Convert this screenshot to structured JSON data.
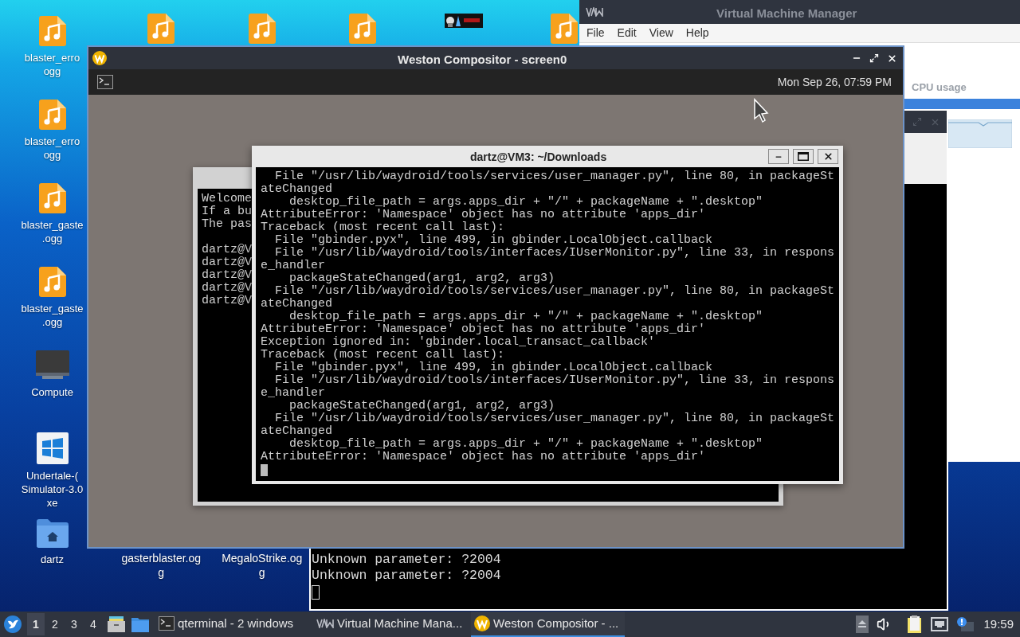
{
  "desktop": {
    "left_column": [
      {
        "kind": "audio",
        "lines": [
          "blaster_erro",
          "ogg"
        ]
      },
      {
        "kind": "audio",
        "lines": [
          "blaster_erro",
          "ogg"
        ]
      },
      {
        "kind": "audio",
        "lines": [
          "blaster_gaste",
          ".ogg"
        ]
      },
      {
        "kind": "audio",
        "lines": [
          "blaster_gaste",
          ".ogg"
        ]
      },
      {
        "kind": "computer",
        "lines": [
          "Compute"
        ]
      },
      {
        "kind": "executable",
        "lines": [
          "Undertale-(",
          "Simulator-3.0",
          "xe"
        ]
      },
      {
        "kind": "folder",
        "lines": [
          "dartz"
        ]
      }
    ],
    "top_row": [
      {
        "kind": "audio"
      },
      {
        "kind": "audio"
      },
      {
        "kind": "audio"
      },
      {
        "kind": "picture"
      },
      {
        "kind": "audio"
      }
    ],
    "bottom_row": [
      {
        "lines": [
          "gasterblaster.og",
          "g"
        ]
      },
      {
        "lines": [
          "MegaloStrike.og",
          "g"
        ]
      }
    ]
  },
  "vmm_window": {
    "title": "Virtual Machine Manager",
    "menu": [
      "File",
      "Edit",
      "View",
      "Help"
    ],
    "column_header": "CPU usage"
  },
  "qterminal_window": {
    "lines": [
      "Unknown parameter: ?2004",
      "Unknown parameter: ?2004"
    ]
  },
  "weston_window": {
    "title": "Weston Compositor - screen0",
    "clock": "Mon Sep 26, 07:59 PM",
    "back_terminal": {
      "intro_lines": [
        "Welcome",
        "If a bu",
        "The pas"
      ],
      "prompt_lines": [
        "dartz@V",
        "dartz@V",
        "dartz@V",
        "dartz@V",
        "dartz@V"
      ]
    },
    "terminal": {
      "title": "dartz@VM3: ~/Downloads",
      "lines": [
        "  File \"/usr/lib/waydroid/tools/services/user_manager.py\", line 80, in packageSt",
        "ateChanged",
        "    desktop_file_path = args.apps_dir + \"/\" + packageName + \".desktop\"",
        "AttributeError: 'Namespace' object has no attribute 'apps_dir'",
        "Traceback (most recent call last):",
        "  File \"gbinder.pyx\", line 499, in gbinder.LocalObject.callback",
        "  File \"/usr/lib/waydroid/tools/interfaces/IUserMonitor.py\", line 33, in respons",
        "e_handler",
        "    packageStateChanged(arg1, arg2, arg3)",
        "  File \"/usr/lib/waydroid/tools/services/user_manager.py\", line 80, in packageSt",
        "ateChanged",
        "    desktop_file_path = args.apps_dir + \"/\" + packageName + \".desktop\"",
        "AttributeError: 'Namespace' object has no attribute 'apps_dir'",
        "Exception ignored in: 'gbinder.local_transact_callback'",
        "Traceback (most recent call last):",
        "  File \"gbinder.pyx\", line 499, in gbinder.LocalObject.callback",
        "  File \"/usr/lib/waydroid/tools/interfaces/IUserMonitor.py\", line 33, in respons",
        "e_handler",
        "    packageStateChanged(arg1, arg2, arg3)",
        "  File \"/usr/lib/waydroid/tools/services/user_manager.py\", line 80, in packageSt",
        "ateChanged",
        "    desktop_file_path = args.apps_dir + \"/\" + packageName + \".desktop\"",
        "AttributeError: 'Namespace' object has no attribute 'apps_dir'"
      ]
    }
  },
  "taskbar": {
    "workspaces": [
      {
        "label": "1",
        "selected": true
      },
      {
        "label": "2",
        "selected": false
      },
      {
        "label": "3",
        "selected": false
      },
      {
        "label": "4",
        "selected": false
      }
    ],
    "tasks": [
      {
        "kind": "terminal",
        "label": "qterminal - 2 windows",
        "selected": false
      },
      {
        "kind": "vmm",
        "label": "Virtual Machine Mana...",
        "selected": false
      },
      {
        "kind": "weston",
        "label": "Weston Compositor - ...",
        "selected": true
      }
    ],
    "clock": "19:59"
  }
}
